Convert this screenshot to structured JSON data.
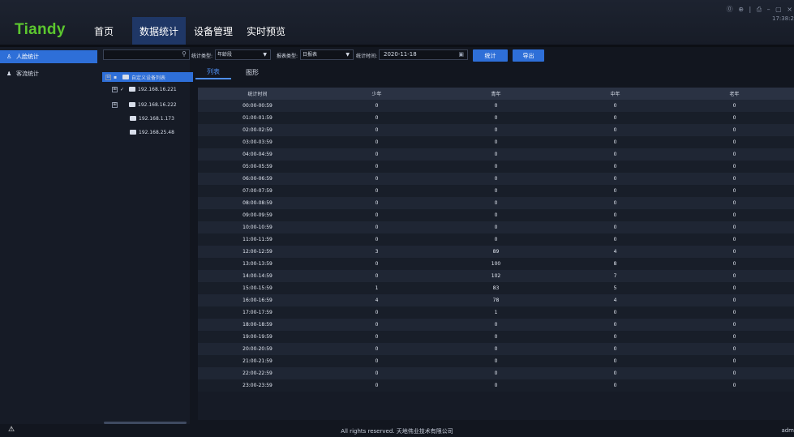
{
  "app": {
    "logo": "Tiandy",
    "nav": [
      "首页",
      "数据统计",
      "设备管理",
      "实时预览"
    ],
    "active_nav": 1,
    "window_controls": "⓪ ⊕ | ⎙ – ▢ ×",
    "clock": "17:38:2"
  },
  "sidebar": {
    "items": [
      {
        "icon": "person-icon",
        "glyph": "♙",
        "label": "人脸统计"
      },
      {
        "icon": "group-icon",
        "glyph": "♟",
        "label": "客流统计"
      }
    ]
  },
  "tree": {
    "search_placeholder": "",
    "root": {
      "expand": "⊟",
      "check": "▪",
      "label": "自定义设备列表"
    },
    "nodes": [
      {
        "expand": "⊞",
        "check": "✓",
        "label": "192.168.16.221"
      },
      {
        "expand": "⊞",
        "check": "",
        "label": "192.168.16.222"
      },
      {
        "expand": "",
        "check": "",
        "label": "192.168.1.173"
      },
      {
        "expand": "",
        "check": "",
        "label": "192.168.25.48"
      }
    ]
  },
  "filters": {
    "type_label": "统计类型:",
    "type_value": "年龄段",
    "report_label": "报表类型:",
    "report_value": "日报表",
    "time_label": "统计时间:",
    "date_value": "2020-11-18",
    "stat_button": "统计",
    "export_button": "导出"
  },
  "tabs": [
    "列表",
    "图形"
  ],
  "active_tab": 0,
  "table": {
    "headers": [
      "统计时间",
      "少年",
      "青年",
      "中年",
      "老年"
    ],
    "rows": [
      [
        "00:00-00:59",
        "0",
        "0",
        "0",
        "0"
      ],
      [
        "01:00-01:59",
        "0",
        "0",
        "0",
        "0"
      ],
      [
        "02:00-02:59",
        "0",
        "0",
        "0",
        "0"
      ],
      [
        "03:00-03:59",
        "0",
        "0",
        "0",
        "0"
      ],
      [
        "04:00-04:59",
        "0",
        "0",
        "0",
        "0"
      ],
      [
        "05:00-05:59",
        "0",
        "0",
        "0",
        "0"
      ],
      [
        "06:00-06:59",
        "0",
        "0",
        "0",
        "0"
      ],
      [
        "07:00-07:59",
        "0",
        "0",
        "0",
        "0"
      ],
      [
        "08:00-08:59",
        "0",
        "0",
        "0",
        "0"
      ],
      [
        "09:00-09:59",
        "0",
        "0",
        "0",
        "0"
      ],
      [
        "10:00-10:59",
        "0",
        "0",
        "0",
        "0"
      ],
      [
        "11:00-11:59",
        "0",
        "0",
        "0",
        "0"
      ],
      [
        "12:00-12:59",
        "3",
        "89",
        "4",
        "0"
      ],
      [
        "13:00-13:59",
        "0",
        "100",
        "8",
        "0"
      ],
      [
        "14:00-14:59",
        "0",
        "102",
        "7",
        "0"
      ],
      [
        "15:00-15:59",
        "1",
        "83",
        "5",
        "0"
      ],
      [
        "16:00-16:59",
        "4",
        "78",
        "4",
        "0"
      ],
      [
        "17:00-17:59",
        "0",
        "1",
        "0",
        "0"
      ],
      [
        "18:00-18:59",
        "0",
        "0",
        "0",
        "0"
      ],
      [
        "19:00-19:59",
        "0",
        "0",
        "0",
        "0"
      ],
      [
        "20:00-20:59",
        "0",
        "0",
        "0",
        "0"
      ],
      [
        "21:00-21:59",
        "0",
        "0",
        "0",
        "0"
      ],
      [
        "22:00-22:59",
        "0",
        "0",
        "0",
        "0"
      ],
      [
        "23:00-23:59",
        "0",
        "0",
        "0",
        "0"
      ]
    ]
  },
  "footer": {
    "warning_glyph": "⚠",
    "copyright": "All rights reserved. 天地伟业技术有限公司",
    "user": "adm"
  },
  "colors": {
    "accent": "#2e6fd8",
    "logo_green": "#5cc72f",
    "tab_active": "#4f8ff0"
  }
}
